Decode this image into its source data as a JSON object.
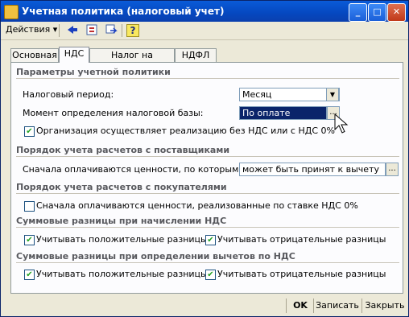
{
  "window": {
    "title": "Учетная политика (налоговый учет)",
    "buttons": {
      "minimize": "_",
      "maximize": "□",
      "close": "✕"
    }
  },
  "toolbar": {
    "actions_label": "Действия",
    "actions_arrow": "▾",
    "icons": [
      "back-arrow-icon",
      "refresh-icon",
      "move-icon",
      "help-icon"
    ],
    "help_glyph": "?"
  },
  "tabs": [
    {
      "label": "Основная",
      "active": false
    },
    {
      "label": "НДС",
      "active": true
    },
    {
      "label": "Налог на прибыль",
      "active": false
    },
    {
      "label": "НДФЛ",
      "active": false
    }
  ],
  "section1": {
    "title": "Параметры учетной политики",
    "tax_period_label": "Налоговый период:",
    "tax_period_value": "Месяц",
    "tax_base_label": "Момент определения налоговой базы:",
    "tax_base_value": "По оплате",
    "ellipsis": "...",
    "no_vat_checkbox_label": "Организация осуществляет реализацию без НДС или с НДС 0%",
    "no_vat_checked": true
  },
  "section2": {
    "title": "Порядок учета расчетов с поставщиками",
    "label": "Сначала оплачиваются ценности, по которым НДС",
    "value": "может быть принят к вычету",
    "ellipsis": "..."
  },
  "section3": {
    "title": "Порядок учета расчетов с покупателями",
    "checkbox_label": "Сначала оплачиваются ценности, реализованные по ставке НДС 0%",
    "checked": false
  },
  "section4": {
    "title": "Суммовые разницы при начислении НДС",
    "positive_label": "Учитывать положительные разницы",
    "negative_label": "Учитывать отрицательные разницы",
    "positive_checked": true,
    "negative_checked": true
  },
  "section5": {
    "title": "Суммовые разницы при определении вычетов по НДС",
    "positive_label": "Учитывать положительные разницы",
    "negative_label": "Учитывать отрицательные разницы",
    "positive_checked": true,
    "negative_checked": true
  },
  "footer": {
    "ok": "OK",
    "save": "Записать",
    "close": "Закрыть"
  },
  "check_glyph": "✔"
}
